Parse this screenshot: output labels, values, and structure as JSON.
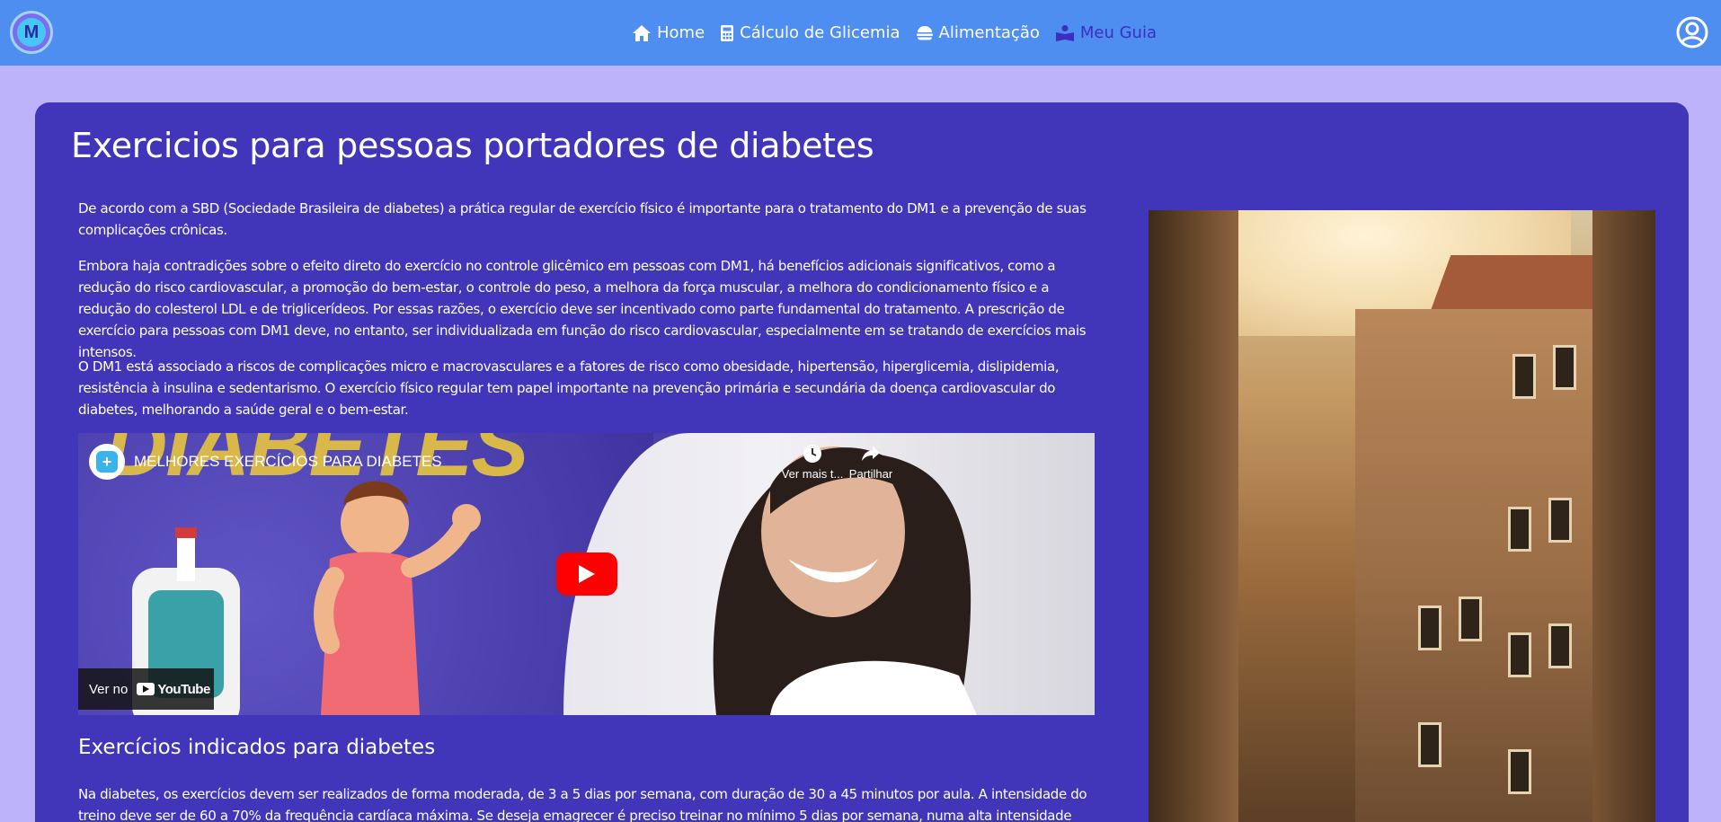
{
  "nav": {
    "items": [
      {
        "label": "Home",
        "icon": "home-icon"
      },
      {
        "label": "Cálculo de Glicemia",
        "icon": "calculator-icon"
      },
      {
        "label": "Alimentação",
        "icon": "food-icon"
      },
      {
        "label": "Meu Guia",
        "icon": "guide-icon",
        "active": true
      }
    ],
    "colors": {
      "bar": "#4e8ef0",
      "active": "#3b2fbf"
    }
  },
  "page": {
    "title": "Exercicios para pessoas portadores de diabetes",
    "paragraphs": [
      "De acordo com a SBD (Sociedade Brasileira de diabetes) a prática regular de exercício físico é importante para o tratamento do DM1 e a prevenção de suas complicações crônicas.",
      "Embora haja contradições sobre o efeito direto do exercício no controle glicêmico em pessoas com DM1, há benefícios adicionais significativos, como a redução do risco cardiovascular, a promoção do bem-estar, o controle do peso, a melhora da força muscular, a melhora do condicionamento físico e a redução do colesterol LDL e de triglicerídeos. Por essas razões, o exercício deve ser incentivado como parte fundamental do tratamento. A prescrição de exercício para pessoas com DM1 deve, no entanto, ser individualizada em função do risco cardiovascular, especialmente em se tratando de exercícios mais intensos.",
      "O DM1 está associado a riscos de complicações micro e macrovasculares e a fatores de risco como obesidade, hipertensão, hiperglicemia, dislipidemia, resistência à insulina e sedentarismo. O exercício físico regular tem papel importante na prevenção primária e secundária da doença cardiovascular do diabetes, melhorando a saúde geral e o bem-estar."
    ],
    "subtitle": "Exercícios indicados para diabetes",
    "paragraph_after": "Na diabetes, os exercícios devem ser realizados de forma moderada, de 3 a 5 dias por semana, com duração de 30 a 45 minutos por aula. A intensidade do treino deve ser de 60 a 70% da frequência cardíaca máxima. Se deseja emagrecer é preciso treinar no mínimo 5 dias por semana, numa alta intensidade para"
  },
  "video": {
    "title": "MELHORES EXERCÍCIOS PARA DIABETES",
    "thumbnail_text": "DIABETES",
    "watch_later": "Ver mais t...",
    "share": "Partilhar",
    "watch_on": "Ver no",
    "youtube": "YouTube"
  },
  "colors": {
    "background": "#bdb3fb",
    "card": "#4135b9"
  }
}
